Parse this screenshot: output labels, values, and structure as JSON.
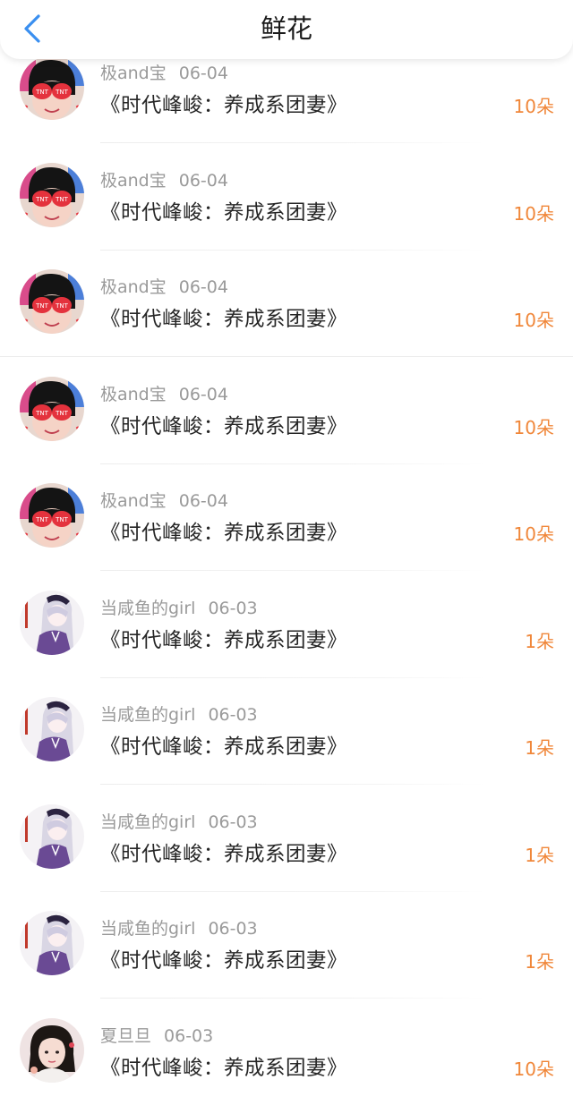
{
  "header": {
    "title": "鲜花",
    "back_icon": "chevron-left-icon",
    "accent_color": "#3a8ff0"
  },
  "colors": {
    "amount": "#f0873a",
    "meta": "#9a9a9a"
  },
  "items": [
    {
      "user": "极and宝",
      "date": "06-04",
      "book": "《时代峰峻：养成系团妻》",
      "amount": "10朵",
      "avatar": "avatar-tnt"
    },
    {
      "user": "极and宝",
      "date": "06-04",
      "book": "《时代峰峻：养成系团妻》",
      "amount": "10朵",
      "avatar": "avatar-tnt"
    },
    {
      "user": "极and宝",
      "date": "06-04",
      "book": "《时代峰峻：养成系团妻》",
      "amount": "10朵",
      "avatar": "avatar-tnt"
    },
    {
      "user": "极and宝",
      "date": "06-04",
      "book": "《时代峰峻：养成系团妻》",
      "amount": "10朵",
      "avatar": "avatar-tnt"
    },
    {
      "user": "极and宝",
      "date": "06-04",
      "book": "《时代峰峻：养成系团妻》",
      "amount": "10朵",
      "avatar": "avatar-tnt"
    },
    {
      "user": "当咸鱼的girl",
      "date": "06-03",
      "book": "《时代峰峻：养成系团妻》",
      "amount": "1朵",
      "avatar": "avatar-anime-girl"
    },
    {
      "user": "当咸鱼的girl",
      "date": "06-03",
      "book": "《时代峰峻：养成系团妻》",
      "amount": "1朵",
      "avatar": "avatar-anime-girl"
    },
    {
      "user": "当咸鱼的girl",
      "date": "06-03",
      "book": "《时代峰峻：养成系团妻》",
      "amount": "1朵",
      "avatar": "avatar-anime-girl"
    },
    {
      "user": "当咸鱼的girl",
      "date": "06-03",
      "book": "《时代峰峻：养成系团妻》",
      "amount": "1朵",
      "avatar": "avatar-anime-girl"
    },
    {
      "user": "夏旦旦",
      "date": "06-03",
      "book": "《时代峰峻：养成系团妻》",
      "amount": "10朵",
      "avatar": "avatar-photo-girl"
    }
  ]
}
